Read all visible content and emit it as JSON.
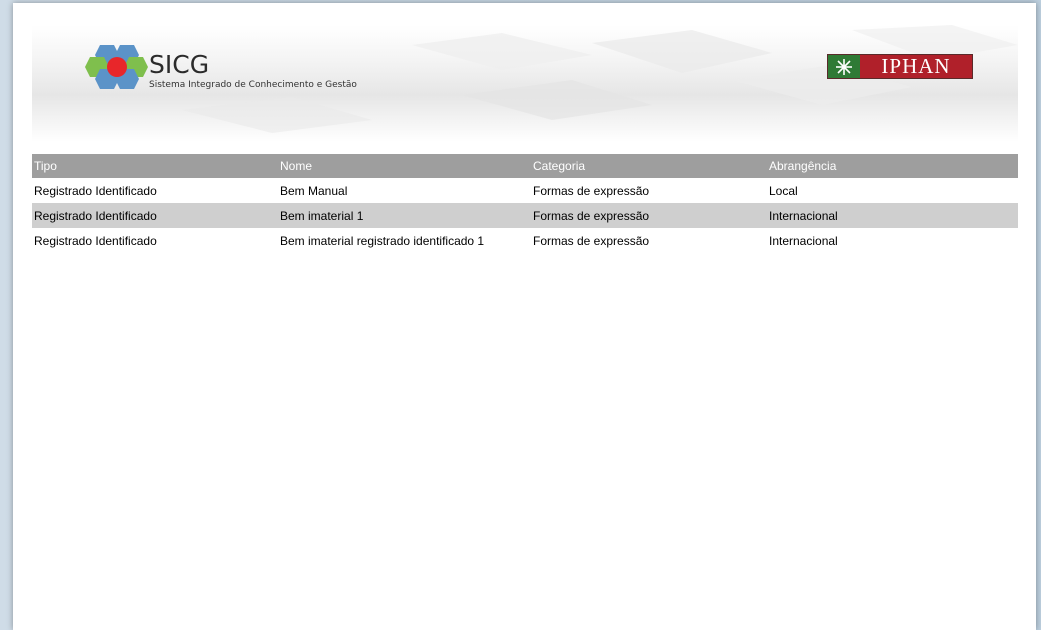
{
  "header": {
    "app_name": "SICG",
    "app_subtitle": "Sistema Integrado de Conhecimento e Gestão",
    "partner_logo_text": "IPHAN",
    "colors": {
      "hex_blue": "#5b93c8",
      "hex_green": "#7fbf4d",
      "hex_red": "#e8262a",
      "iphan_red": "#b0202a",
      "iphan_green": "#2f7a35"
    }
  },
  "table": {
    "columns": [
      "Tipo",
      "Nome",
      "Categoria",
      "Abrangência"
    ],
    "rows": [
      [
        "Registrado Identificado",
        "Bem Manual",
        "Formas de expressão",
        "Local"
      ],
      [
        "Registrado Identificado",
        "Bem imaterial 1",
        "Formas de expressão",
        "Internacional"
      ],
      [
        "Registrado Identificado",
        "Bem imaterial registrado identificado 1",
        "Formas de expressão",
        "Internacional"
      ]
    ],
    "colors": {
      "header_bg": "#9e9e9e",
      "alt_row_bg": "#cfcfcf"
    }
  }
}
